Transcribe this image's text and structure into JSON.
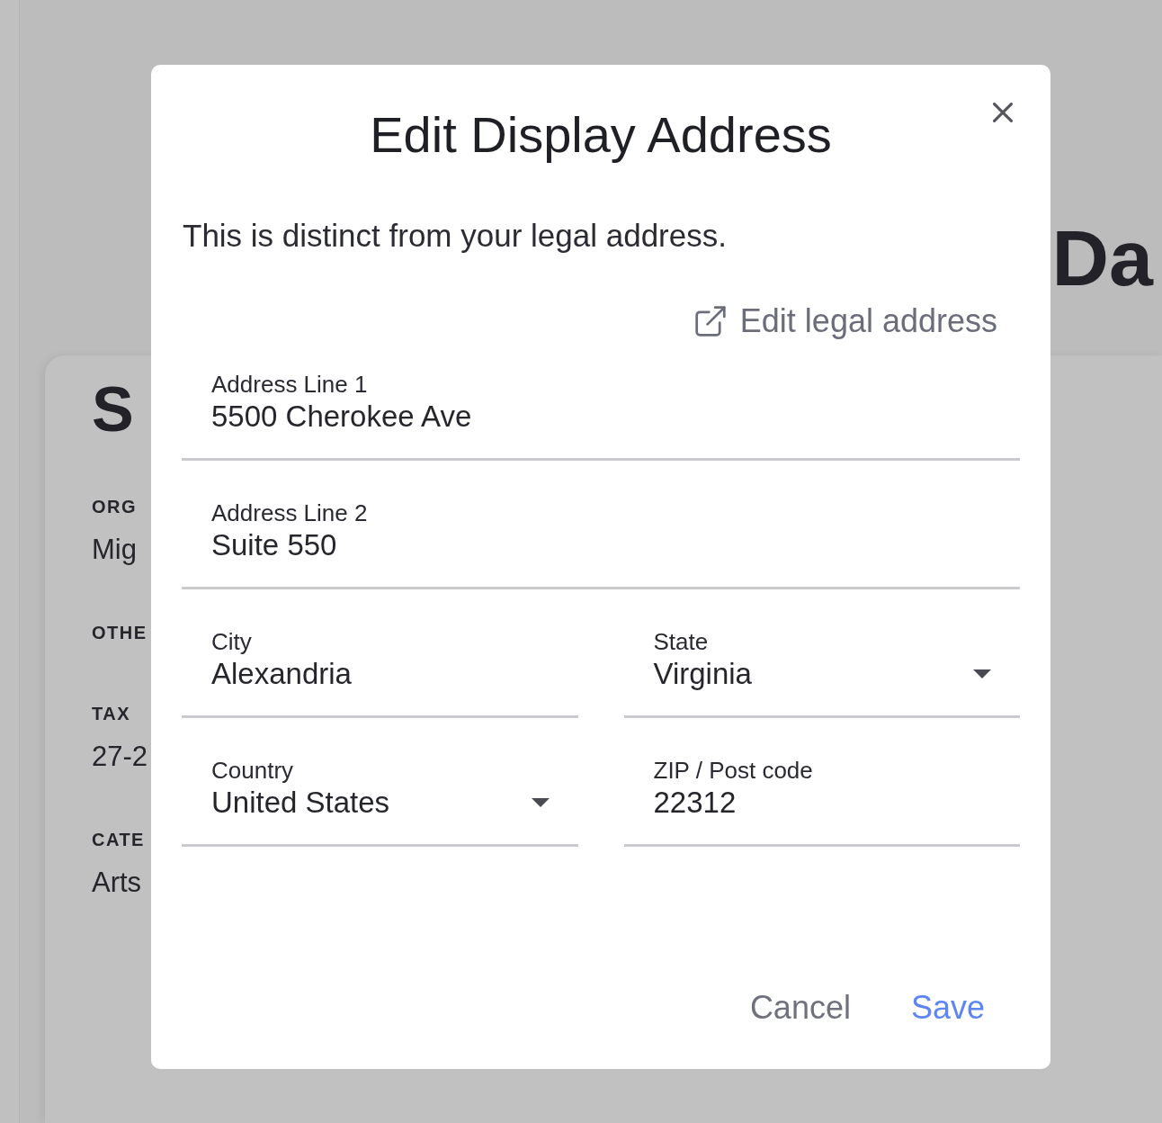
{
  "page": {
    "title": "Da",
    "card": {
      "title": "S",
      "fields": [
        {
          "label": "ORG",
          "value": "Mig"
        },
        {
          "label": "OTHE"
        },
        {
          "label": "TAX",
          "value": "27-2"
        },
        {
          "label": "CATE",
          "value": "Arts"
        }
      ]
    }
  },
  "dialog": {
    "title": "Edit Display Address",
    "description": "This is distinct from your legal address.",
    "legal_link": "Edit legal address",
    "field_rows": [
      [
        {
          "kind": "text",
          "label": "Address Line 1",
          "value": "5500 Cherokee Ave"
        }
      ],
      [
        {
          "kind": "text",
          "label": "Address Line 2",
          "value": "Suite 550"
        }
      ],
      [
        {
          "kind": "text",
          "label": "City",
          "value": "Alexandria"
        },
        {
          "kind": "select",
          "label": "State",
          "value": "Virginia"
        }
      ],
      [
        {
          "kind": "select",
          "label": "Country",
          "value": "United States"
        },
        {
          "kind": "text",
          "label": "ZIP / Post code",
          "value": "22312"
        }
      ]
    ],
    "buttons": [
      {
        "kind": "secondary",
        "label": "Cancel"
      },
      {
        "kind": "primary",
        "label": "Save"
      }
    ]
  }
}
